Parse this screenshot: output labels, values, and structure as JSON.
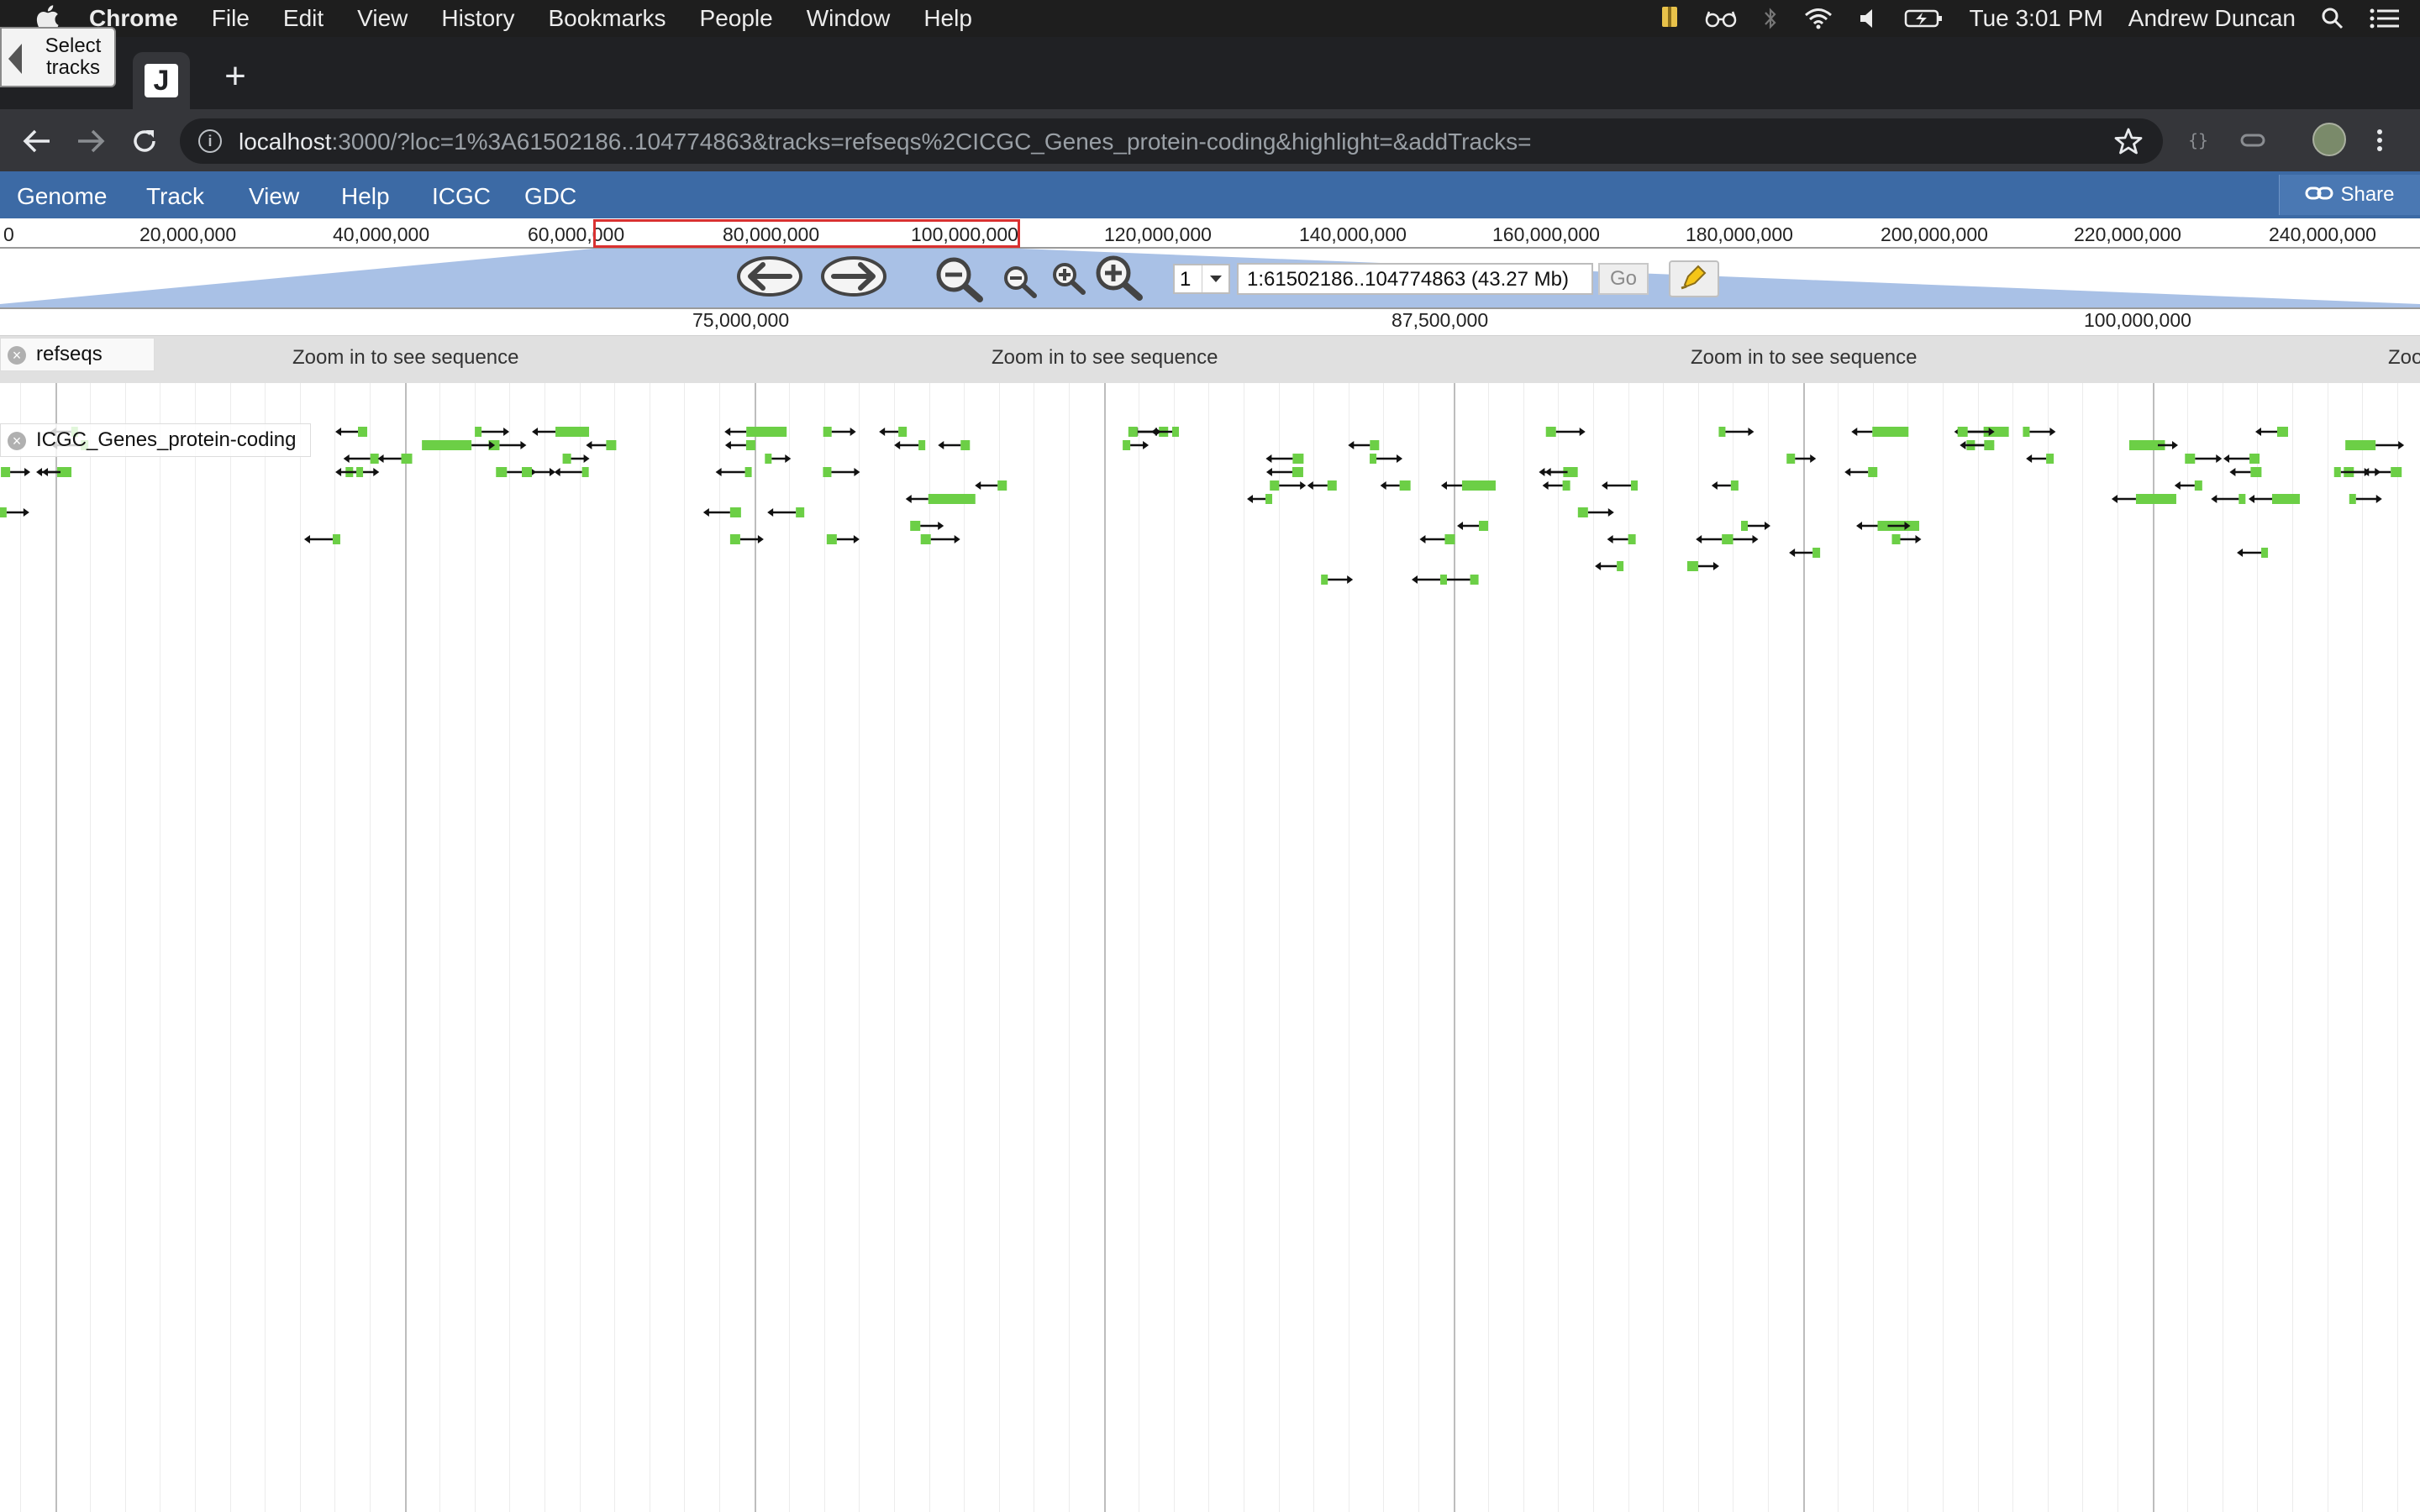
{
  "menubar": {
    "app_name": "Chrome",
    "items": [
      "File",
      "Edit",
      "View",
      "History",
      "Bookmarks",
      "People",
      "Window",
      "Help"
    ],
    "clock": "Tue 3:01 PM",
    "user": "Andrew Duncan"
  },
  "browser": {
    "tab_favicon_letter": "J",
    "url_host": "localhost",
    "url_rest": ":3000/?loc=1%3A61502186..104774863&tracks=refseqs%2CICGC_Genes_protein-coding&highlight=&addTracks="
  },
  "jbrowse": {
    "menus": [
      "Genome",
      "Track",
      "View",
      "Help",
      "ICGC",
      "GDC"
    ],
    "share_label": "Share",
    "overview_ticks": [
      "0",
      "20,000,000",
      "40,000,000",
      "60,000,000",
      "80,000,000",
      "100,000,000",
      "120,000,000",
      "140,000,000",
      "160,000,000",
      "180,000,000",
      "200,000,000",
      "220,000,000",
      "240,000,000"
    ],
    "detail_ticks": [
      "75,000,000",
      "87,500,000",
      "100,000,000"
    ],
    "select_tracks_line1": "Select",
    "select_tracks_line2": "tracks",
    "chromosome": "1",
    "location": "1:61502186..104774863 (43.27 Mb)",
    "go_label": "Go",
    "zoom_message": "Zoom in to see sequence",
    "zoom_message_cut": "Zoo",
    "tracks": [
      {
        "label": "refseqs"
      },
      {
        "label": "ICGC_Genes_protein-coding"
      }
    ]
  },
  "colors": {
    "jbrowse_menubar": "#3c6aa5",
    "feature_green": "#6ccf46",
    "overview_highlight": "#d93030"
  }
}
